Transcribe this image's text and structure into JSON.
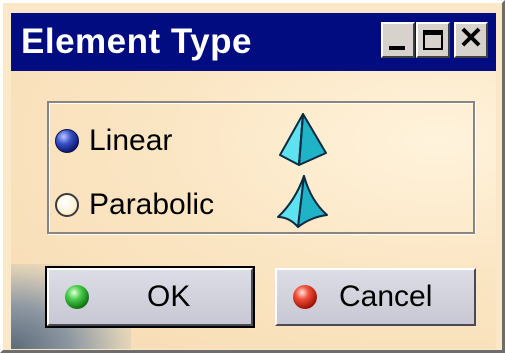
{
  "window": {
    "title": "Element Type",
    "controls": {
      "minimize_icon": "minimize-icon",
      "maximize_icon": "maximize-icon",
      "close_glyph": "✕"
    }
  },
  "options": {
    "selected": "Linear",
    "items": [
      {
        "label": "Linear",
        "checked": true,
        "icon": "linear-tetrahedron-icon"
      },
      {
        "label": "Parabolic",
        "checked": false,
        "icon": "parabolic-tetrahedron-icon"
      }
    ]
  },
  "buttons": {
    "ok": {
      "label": "OK",
      "icon": "green-ball-icon",
      "default": true
    },
    "cancel": {
      "label": "Cancel",
      "icon": "red-ball-icon"
    }
  },
  "colors": {
    "titlebar": "#000c80",
    "background": "#fbe8c8",
    "icon_fill": "#3fd0e0",
    "radio_selected": "#3a50c8"
  }
}
